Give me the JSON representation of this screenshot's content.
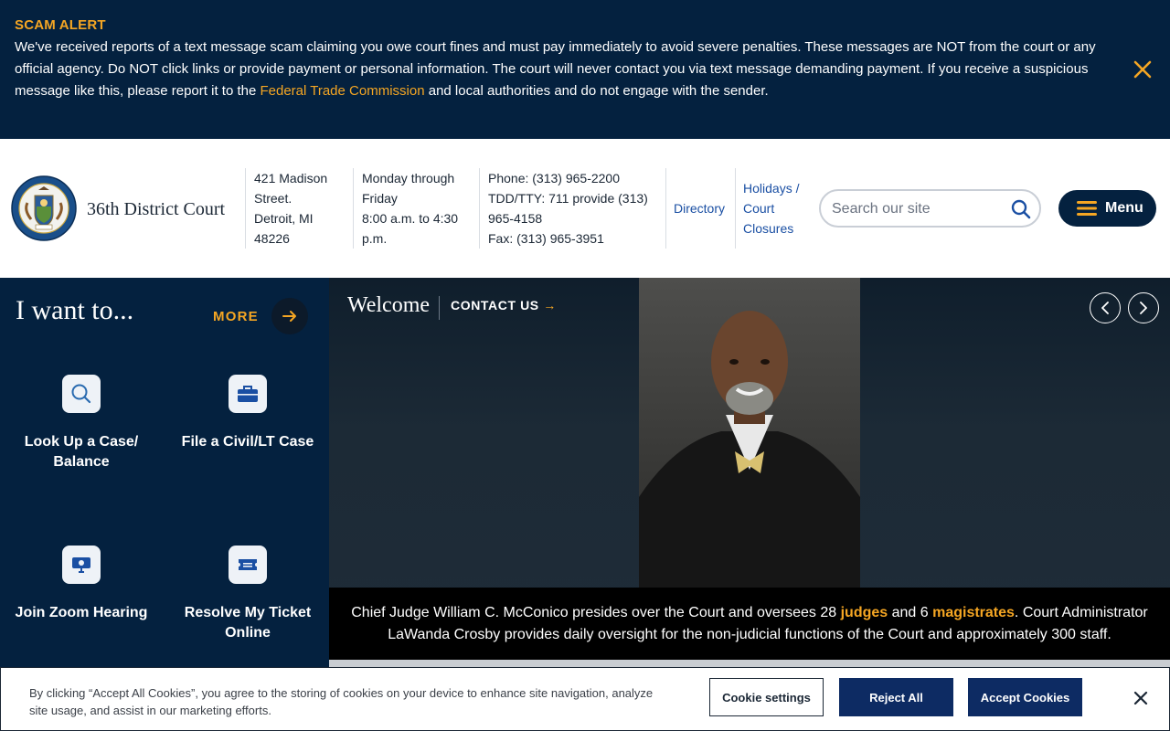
{
  "alert": {
    "title": "SCAM ALERT",
    "text_before": "We've received reports of a text message scam claiming you owe court fines and must pay immediately to avoid severe penalties. These messages are NOT from the court or any official agency. Do NOT click links or provide payment or personal information. The court will never contact you via text message demanding payment. If you receive a suspicious message like this, please report it to the ",
    "link_text": "Federal Trade Commission",
    "text_after": " and local authorities and do not engage with the sender."
  },
  "header": {
    "court_name": "36th District Court",
    "address": [
      "421 Madison",
      "Street.",
      "Detroit, MI",
      "48226"
    ],
    "hours": [
      "Monday through",
      "Friday",
      "8:00 a.m. to 4:30",
      "p.m."
    ],
    "contact": [
      "Phone: (313) 965-2200",
      "TDD/TTY: 711 provide (313)",
      "965-4158",
      "Fax: (313) 965-3951"
    ],
    "directory_label": "Directory",
    "holidays_label": [
      "Holidays /",
      "Court",
      "Closures"
    ],
    "search_placeholder": "Search our site",
    "menu_label": "Menu"
  },
  "i_want_to": {
    "heading": "I want to...",
    "more_label": "MORE",
    "tasks": [
      {
        "label_lines": [
          "Look Up a Case/",
          "Balance"
        ],
        "icon": "search-icon"
      },
      {
        "label_lines": [
          "File a Civil/LT Case"
        ],
        "icon": "briefcase-icon"
      },
      {
        "label_lines": [
          "Join Zoom Hearing"
        ],
        "icon": "video-call-icon"
      },
      {
        "label_lines": [
          "Resolve My Ticket",
          "Online"
        ],
        "icon": "ticket-icon"
      }
    ]
  },
  "hero": {
    "welcome": "Welcome",
    "contact_label": "CONTACT US",
    "caption_part1": "Chief Judge William C. McConico presides over the Court and oversees 28 ",
    "caption_link1": "judges",
    "caption_part2": " and 6 ",
    "caption_link2": "magistrates",
    "caption_part3": ". Court Administrator LaWanda Crosby provides daily oversight for the non-judicial functions of the Court and approximately 300 staff."
  },
  "cookie": {
    "text": "By clicking “Accept All Cookies”, you agree to the storing of cookies on your device to enhance site navigation, analyze site usage, and assist in our marketing efforts.",
    "settings_label": "Cookie settings",
    "reject_label": "Reject All",
    "accept_label": "Accept Cookies"
  },
  "colors": {
    "navy": "#04213f",
    "accent_orange": "#f5a623",
    "link_blue": "#1a4fa3",
    "button_blue": "#0d2b63"
  }
}
